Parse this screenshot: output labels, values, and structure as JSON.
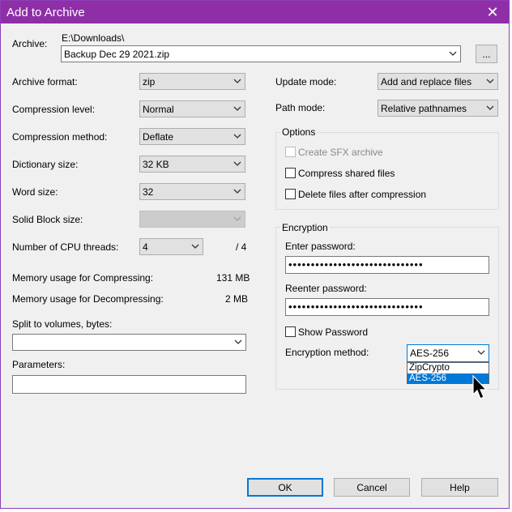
{
  "window": {
    "title": "Add to Archive",
    "accent_color": "#8e2fa8"
  },
  "archive": {
    "label": "Archive:",
    "path": "E:\\Downloads\\",
    "value": "Backup Dec 29 2021.zip",
    "browse_label": "..."
  },
  "left": {
    "archive_format": {
      "label": "Archive format:",
      "value": "zip"
    },
    "compression_level": {
      "label": "Compression level:",
      "value": "Normal"
    },
    "compression_method": {
      "label": "Compression method:",
      "value": "Deflate"
    },
    "dictionary_size": {
      "label": "Dictionary size:",
      "value": "32 KB"
    },
    "word_size": {
      "label": "Word size:",
      "value": "32"
    },
    "solid_block_size": {
      "label": "Solid Block size:",
      "value": ""
    },
    "cpu_threads": {
      "label": "Number of CPU threads:",
      "value": "4",
      "max": "/ 4"
    },
    "memory_compress": {
      "label": "Memory usage for Compressing:",
      "value": "131 MB"
    },
    "memory_decompress": {
      "label": "Memory usage for Decompressing:",
      "value": "2 MB"
    },
    "split": {
      "label": "Split to volumes, bytes:",
      "value": ""
    },
    "parameters": {
      "label": "Parameters:",
      "value": ""
    }
  },
  "right": {
    "update_mode": {
      "label": "Update mode:",
      "value": "Add and replace files"
    },
    "path_mode": {
      "label": "Path mode:",
      "value": "Relative pathnames"
    },
    "options": {
      "title": "Options",
      "create_sfx": "Create SFX archive",
      "compress_shared": "Compress shared files",
      "delete_after": "Delete files after compression"
    },
    "encryption": {
      "title": "Encryption",
      "enter_password_label": "Enter password:",
      "enter_password_value": "••••••••••••••••••••••••••••••",
      "reenter_password_label": "Reenter password:",
      "reenter_password_value": "••••••••••••••••••••••••••••••",
      "show_password": "Show Password",
      "method_label": "Encryption method:",
      "method_value": "AES-256",
      "method_options": [
        "ZipCrypto",
        "AES-256"
      ],
      "selected_option": "AES-256"
    }
  },
  "buttons": {
    "ok": "OK",
    "cancel": "Cancel",
    "help": "Help"
  }
}
